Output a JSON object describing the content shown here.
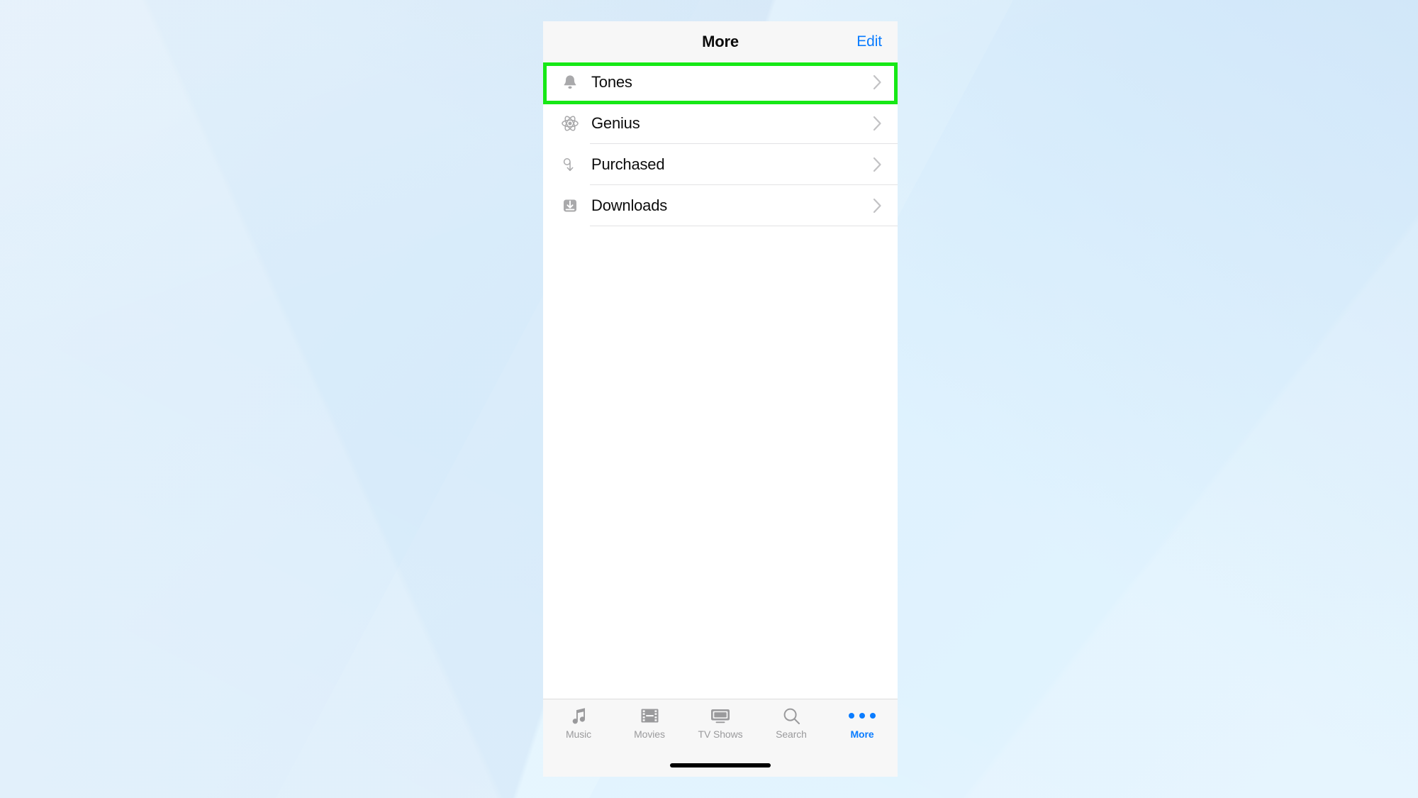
{
  "wallpaper": {
    "base_color": "#c3dbf5",
    "accent_color": "#bcd4f1"
  },
  "highlight": {
    "color": "#16e816",
    "target": "Tones"
  },
  "navbar": {
    "title": "More",
    "edit_label": "Edit",
    "background": "#f7f7f7",
    "accent": "#0a7cff"
  },
  "list": {
    "rows": [
      {
        "label": "Tones",
        "icon": "bell-icon",
        "chevron": "chevron-right-icon",
        "highlighted": true
      },
      {
        "label": "Genius",
        "icon": "atom-icon",
        "chevron": "chevron-right-icon",
        "highlighted": false
      },
      {
        "label": "Purchased",
        "icon": "purchased-icon",
        "chevron": "chevron-right-icon",
        "highlighted": false
      },
      {
        "label": "Downloads",
        "icon": "download-icon",
        "chevron": "chevron-right-icon",
        "highlighted": false
      }
    ]
  },
  "tabbar": {
    "background": "#f7f7f7",
    "inactive_color": "#9a9a9c",
    "active_color": "#0a7cff",
    "tabs": [
      {
        "label": "Music",
        "icon": "music-note-icon",
        "active": false
      },
      {
        "label": "Movies",
        "icon": "film-strip-icon",
        "active": false
      },
      {
        "label": "TV Shows",
        "icon": "television-icon",
        "active": false
      },
      {
        "label": "Search",
        "icon": "search-icon",
        "active": false
      },
      {
        "label": "More",
        "icon": "ellipsis-icon",
        "active": true
      }
    ]
  },
  "home_indicator": {
    "color": "#000000"
  }
}
